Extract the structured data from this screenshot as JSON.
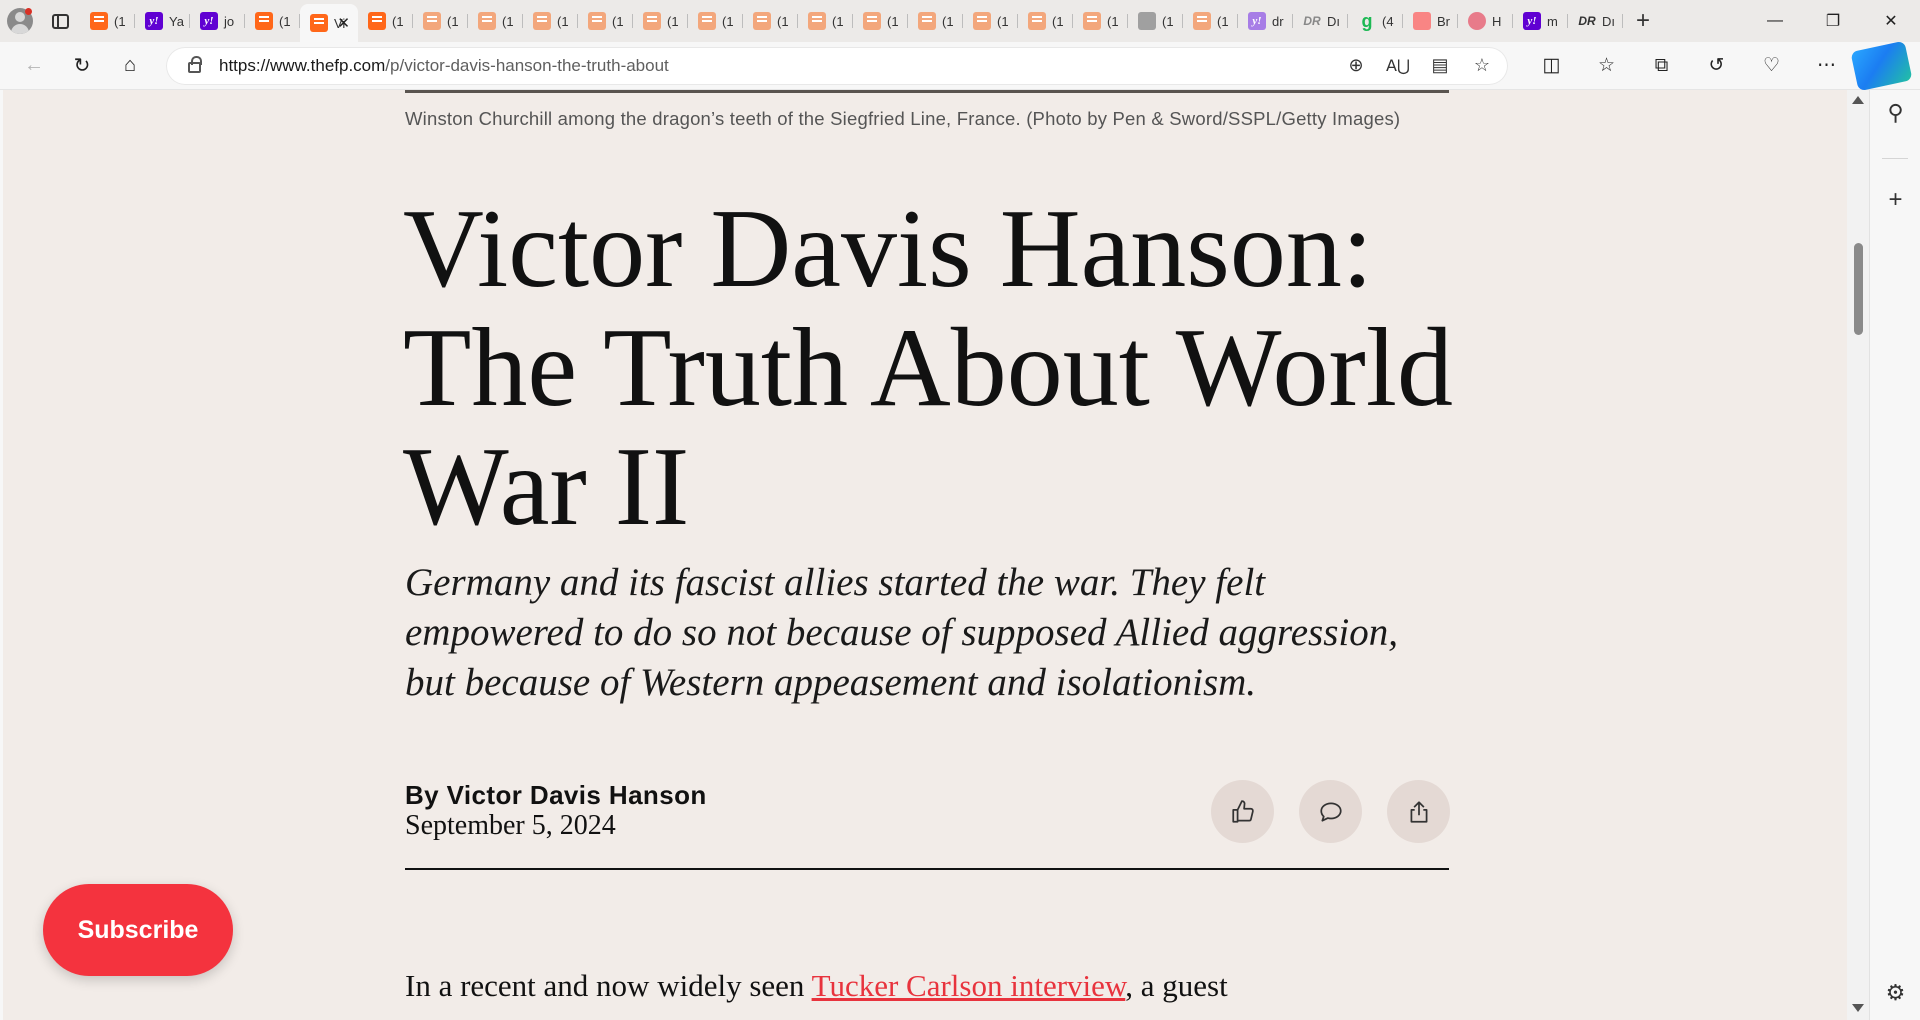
{
  "browser": {
    "tabs": [
      {
        "icon": "substack",
        "label": "(1",
        "faded": false
      },
      {
        "icon": "yahoo",
        "label": "Ya",
        "faded": false
      },
      {
        "icon": "yahoo",
        "label": "jo",
        "faded": false
      },
      {
        "icon": "substack",
        "label": "(1",
        "faded": false
      },
      {
        "icon": "substack",
        "label": "Vi",
        "faded": false,
        "active": true
      },
      {
        "icon": "substack",
        "label": "(1",
        "faded": false
      },
      {
        "icon": "substack",
        "label": "(1",
        "faded": true
      },
      {
        "icon": "substack",
        "label": "(1",
        "faded": true
      },
      {
        "icon": "substack",
        "label": "(1",
        "faded": true
      },
      {
        "icon": "substack",
        "label": "(1",
        "faded": true
      },
      {
        "icon": "substack",
        "label": "(1",
        "faded": true
      },
      {
        "icon": "substack",
        "label": "(1",
        "faded": true
      },
      {
        "icon": "substack",
        "label": "(1",
        "faded": true
      },
      {
        "icon": "substack",
        "label": "(1",
        "faded": true
      },
      {
        "icon": "substack",
        "label": "(1",
        "faded": true
      },
      {
        "icon": "substack",
        "label": "(1",
        "faded": true
      },
      {
        "icon": "substack",
        "label": "(1",
        "faded": true
      },
      {
        "icon": "substack",
        "label": "(1",
        "faded": true
      },
      {
        "icon": "substack",
        "label": "(1",
        "faded": true
      },
      {
        "icon": "gray",
        "label": "(1",
        "faded": true
      },
      {
        "icon": "substack",
        "label": "(1",
        "faded": true
      },
      {
        "icon": "yahoo",
        "label": "dr",
        "faded": true
      },
      {
        "icon": "dr",
        "label": "Dı",
        "faded": true
      },
      {
        "icon": "green",
        "label": "(4",
        "faded": false
      },
      {
        "icon": "yt",
        "label": "Br",
        "faded": true
      },
      {
        "icon": "pin",
        "label": "H",
        "faded": true
      },
      {
        "icon": "yahoo",
        "label": "m",
        "faded": false
      },
      {
        "icon": "dr",
        "label": "Dı",
        "faded": false
      }
    ],
    "url_host": "https://www.thefp.com",
    "url_path": "/p/victor-davis-hanson-the-truth-about"
  },
  "article": {
    "caption": "Winston Churchill among the dragon’s teeth of the Siegfried Line, France. (Photo by Pen & Sword/SSPL/Getty Images)",
    "title": "Victor Davis Hanson: The Truth About World War II",
    "dek": "Germany and its fascist allies started the war. They felt empowered to do so not because of supposed Allied aggression, but because of Western appeasement and isolationism.",
    "byline": "By Victor Davis Hanson",
    "date": "September 5, 2024",
    "body_start": "In a recent and now widely seen ",
    "body_link": "Tucker Carlson interview",
    "body_end": ", a guest"
  },
  "subscribe_label": "Subscribe",
  "colors": {
    "page_bg": "#f2ece8",
    "accent": "#f4333e",
    "link": "#e8333d",
    "action_bg": "#e4d9d4"
  }
}
